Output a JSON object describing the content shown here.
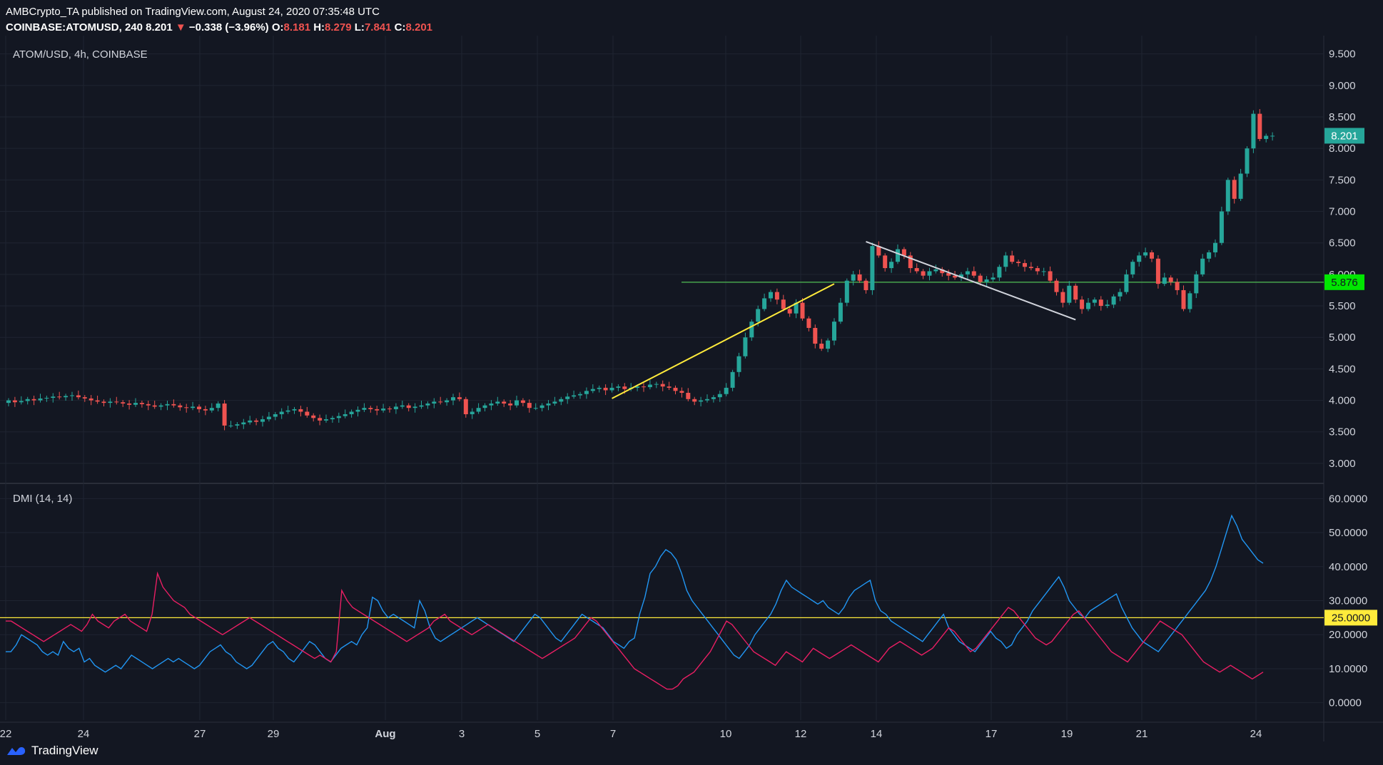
{
  "header": {
    "line1": "AMBCrypto_TA published on TradingView.com, August 24, 2020 07:35:48 UTC",
    "symbol": "COINBASE:ATOMUSD, 240",
    "last": "8.201",
    "change": "−0.338 (−3.96%)",
    "o_label": "O:",
    "o": "8.181",
    "h_label": "H:",
    "h": "8.279",
    "l_label": "L:",
    "l": "7.841",
    "c_label": "C:",
    "c": "8.201"
  },
  "brand": "TradingView",
  "colors": {
    "background": "#131722",
    "grid": "#1f2431",
    "up": "#26a69a",
    "down": "#ef5350",
    "plus_di": "#2196f3",
    "minus_di": "#e91e63",
    "level_line": "#ffeb3b",
    "support_line": "#4caf50",
    "price_label_bg": "#26a69a",
    "support_label_bg": "#00e600"
  },
  "chart_data": [
    {
      "type": "candlestick",
      "title": "ATOM/USD, 4h, COINBASE",
      "y_axis_ticks": [
        "3.000",
        "3.500",
        "4.000",
        "4.500",
        "5.000",
        "5.500",
        "6.000",
        "6.500",
        "7.000",
        "7.500",
        "8.000",
        "8.500",
        "9.000",
        "9.500"
      ],
      "ylim": [
        2.75,
        9.7
      ],
      "x_tick_labels": [
        "22",
        "24",
        "27",
        "29",
        "Aug",
        "3",
        "5",
        "7",
        "10",
        "12",
        "14",
        "17",
        "19",
        "21",
        "24"
      ],
      "last_price_label": "8.201",
      "horizontal_level": {
        "value": 5.876,
        "label": "5.876"
      },
      "trendlines": [
        {
          "name": "ascending support",
          "color": "#ffeb3b",
          "from": {
            "bar": 95,
            "price": 4.03
          },
          "to": {
            "bar": 130,
            "price": 5.85
          }
        },
        {
          "name": "descending resistance",
          "color": "#d1d4dc",
          "from": {
            "bar": 135,
            "price": 6.52
          },
          "to": {
            "bar": 168,
            "price": 5.28
          }
        }
      ],
      "candles_close": [
        4.0,
        3.97,
        3.99,
        4.02,
        4.0,
        4.03,
        4.04,
        4.06,
        4.05,
        4.07,
        4.08,
        4.05,
        4.03,
        4.0,
        3.98,
        3.96,
        3.98,
        3.97,
        3.95,
        3.93,
        3.96,
        3.94,
        3.92,
        3.9,
        3.92,
        3.94,
        3.92,
        3.89,
        3.88,
        3.9,
        3.86,
        3.84,
        3.88,
        3.95,
        3.6,
        3.6,
        3.62,
        3.65,
        3.68,
        3.66,
        3.7,
        3.74,
        3.78,
        3.82,
        3.84,
        3.86,
        3.82,
        3.76,
        3.72,
        3.68,
        3.7,
        3.72,
        3.75,
        3.78,
        3.82,
        3.85,
        3.88,
        3.86,
        3.84,
        3.87,
        3.86,
        3.9,
        3.92,
        3.88,
        3.9,
        3.92,
        3.95,
        3.98,
        3.97,
        4.0,
        4.05,
        4.02,
        3.78,
        3.82,
        3.88,
        3.92,
        3.95,
        3.98,
        3.95,
        3.92,
        4.0,
        3.96,
        3.88,
        3.88,
        3.92,
        3.95,
        3.98,
        4.02,
        4.06,
        4.08,
        4.1,
        4.15,
        4.18,
        4.2,
        4.16,
        4.2,
        4.22,
        4.18,
        4.2,
        4.22,
        4.21,
        4.25,
        4.26,
        4.22,
        4.2,
        4.15,
        4.12,
        4.02,
        3.98,
        4.0,
        4.02,
        4.05,
        4.1,
        4.2,
        4.45,
        4.7,
        5.0,
        5.25,
        5.45,
        5.62,
        5.72,
        5.6,
        5.45,
        5.38,
        5.55,
        5.3,
        5.15,
        4.9,
        4.82,
        4.95,
        5.25,
        5.55,
        5.9,
        6.0,
        5.9,
        5.75,
        6.45,
        6.3,
        6.1,
        6.2,
        6.4,
        6.3,
        6.1,
        6.05,
        5.98,
        6.05,
        6.08,
        6.02,
        5.98,
        5.95,
        6.0,
        6.05,
        5.98,
        5.88,
        5.92,
        5.95,
        6.12,
        6.3,
        6.2,
        6.18,
        6.12,
        6.1,
        6.05,
        6.05,
        5.9,
        5.72,
        5.55,
        5.82,
        5.6,
        5.45,
        5.55,
        5.6,
        5.5,
        5.52,
        5.65,
        5.72,
        6.0,
        6.2,
        6.3,
        6.35,
        6.25,
        5.85,
        5.95,
        5.88,
        5.75,
        5.45,
        5.7,
        6.0,
        6.25,
        6.35,
        6.5,
        7.0,
        7.5,
        7.2,
        7.6,
        8.0,
        8.55,
        8.15,
        8.2,
        8.201
      ]
    },
    {
      "type": "line",
      "title": "DMI (14, 14)",
      "y_axis_ticks": [
        "0.0000",
        "10.0000",
        "20.0000",
        "30.0000",
        "40.0000",
        "50.0000",
        "60.0000"
      ],
      "ylim": [
        -3,
        63
      ],
      "level": {
        "value": 25,
        "label": "25.0000"
      },
      "series": [
        {
          "values": [
            15,
            15,
            17,
            20,
            19,
            18,
            17,
            15,
            14,
            15,
            14,
            18,
            16,
            15,
            16,
            12,
            13,
            11,
            10,
            9,
            10,
            11,
            10,
            12,
            14,
            13,
            12,
            11,
            10,
            11,
            12,
            13,
            12,
            13,
            12,
            11,
            10,
            11,
            13,
            15,
            16,
            17,
            15,
            14,
            12,
            11,
            10,
            11,
            13,
            15,
            17,
            18,
            16,
            15,
            13,
            12,
            14,
            16,
            18,
            17,
            15,
            13,
            12,
            14,
            16,
            17,
            18,
            17,
            20,
            22,
            31,
            30,
            27,
            25,
            26,
            25,
            24,
            23,
            22,
            30,
            27,
            22,
            19,
            18,
            19,
            20,
            21,
            22,
            23,
            24,
            25,
            24,
            23,
            22,
            21,
            20,
            19,
            18,
            20,
            22,
            24,
            26,
            25,
            23,
            21,
            19,
            18,
            20,
            22,
            24,
            26,
            25,
            24,
            23,
            22,
            20,
            18,
            17,
            16,
            18,
            19,
            26,
            31,
            38,
            40,
            43,
            45,
            44,
            42,
            38,
            33,
            30,
            28,
            26,
            24,
            22,
            20,
            18,
            16,
            14,
            13,
            15,
            17,
            20,
            22,
            24,
            26,
            29,
            33,
            36,
            34,
            33,
            32,
            31,
            30,
            29,
            30,
            28,
            27,
            26,
            28,
            31,
            33,
            34,
            35,
            36,
            30,
            27,
            26,
            24,
            23,
            22,
            21,
            20,
            19,
            18,
            20,
            22,
            24,
            26,
            22,
            20,
            18,
            17,
            16,
            15,
            17,
            19,
            21,
            19,
            18,
            16,
            17,
            20,
            22,
            24,
            27,
            29,
            31,
            33,
            35,
            37,
            34,
            30,
            28,
            26,
            25,
            27,
            28,
            29,
            30,
            31,
            32,
            28,
            25,
            22,
            20,
            18,
            17,
            16,
            15,
            17,
            19,
            21,
            23,
            25,
            27,
            29,
            31,
            33,
            36,
            40,
            45,
            50,
            55,
            52,
            48,
            46,
            44,
            42,
            41
          ]
        },
        {
          "values": [
            24,
            24,
            23,
            22,
            21,
            20,
            19,
            18,
            19,
            20,
            21,
            22,
            23,
            22,
            21,
            23,
            26,
            24,
            23,
            22,
            24,
            25,
            26,
            24,
            23,
            22,
            21,
            26,
            38,
            34,
            32,
            30,
            29,
            28,
            26,
            25,
            24,
            23,
            22,
            21,
            20,
            21,
            22,
            23,
            24,
            25,
            24,
            23,
            22,
            21,
            20,
            19,
            18,
            17,
            16,
            15,
            14,
            13,
            14,
            13,
            12,
            15,
            33,
            30,
            28,
            27,
            26,
            25,
            24,
            23,
            22,
            21,
            20,
            19,
            18,
            19,
            20,
            21,
            22,
            24,
            25,
            26,
            24,
            23,
            22,
            21,
            20,
            21,
            22,
            23,
            22,
            21,
            20,
            19,
            18,
            17,
            16,
            15,
            14,
            13,
            14,
            15,
            16,
            17,
            18,
            19,
            21,
            23,
            25,
            24,
            22,
            20,
            18,
            16,
            14,
            12,
            10,
            9,
            8,
            7,
            6,
            5,
            4,
            4,
            5,
            7,
            8,
            9,
            11,
            13,
            15,
            18,
            21,
            24,
            23,
            21,
            19,
            17,
            15,
            14,
            13,
            12,
            11,
            13,
            15,
            14,
            13,
            12,
            14,
            16,
            15,
            14,
            13,
            14,
            15,
            16,
            17,
            16,
            15,
            14,
            13,
            12,
            14,
            16,
            17,
            18,
            17,
            16,
            15,
            14,
            15,
            16,
            18,
            20,
            22,
            21,
            19,
            17,
            15,
            16,
            18,
            20,
            22,
            24,
            26,
            28,
            27,
            25,
            23,
            21,
            19,
            18,
            17,
            18,
            20,
            22,
            24,
            26,
            27,
            25,
            23,
            21,
            19,
            17,
            15,
            14,
            13,
            12,
            14,
            16,
            18,
            20,
            22,
            24,
            23,
            22,
            21,
            20,
            18,
            16,
            14,
            12,
            11,
            10,
            9,
            10,
            11,
            10,
            9,
            8,
            7,
            8,
            9
          ]
        }
      ]
    }
  ]
}
